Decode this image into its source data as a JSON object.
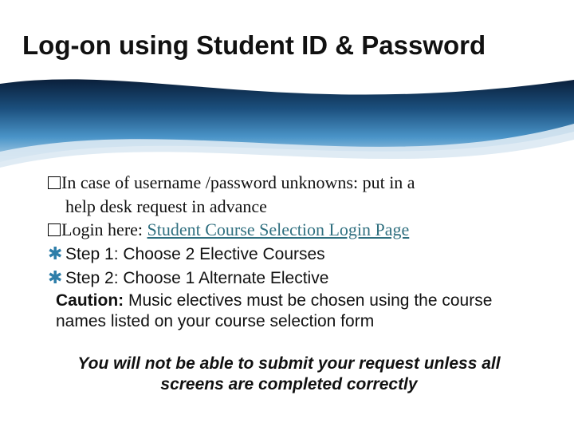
{
  "title": "Log-on using Student ID & Password",
  "lines": {
    "l1a": "In case of username /password unknowns: put in a",
    "l1b": "help desk request in advance",
    "l2a": "Login here: ",
    "l2link": "Student Course Selection Login Page",
    "step1": "Step 1: Choose 2 Elective Courses",
    "step2": "Step 2: Choose 1 Alternate Elective",
    "caution_label": "Caution:",
    "caution_rest": " Music electives must be chosen using the course names listed on your course selection form",
    "final1": "You will not be able to submit your request unless all",
    "final2": "screens are completed correctly"
  }
}
